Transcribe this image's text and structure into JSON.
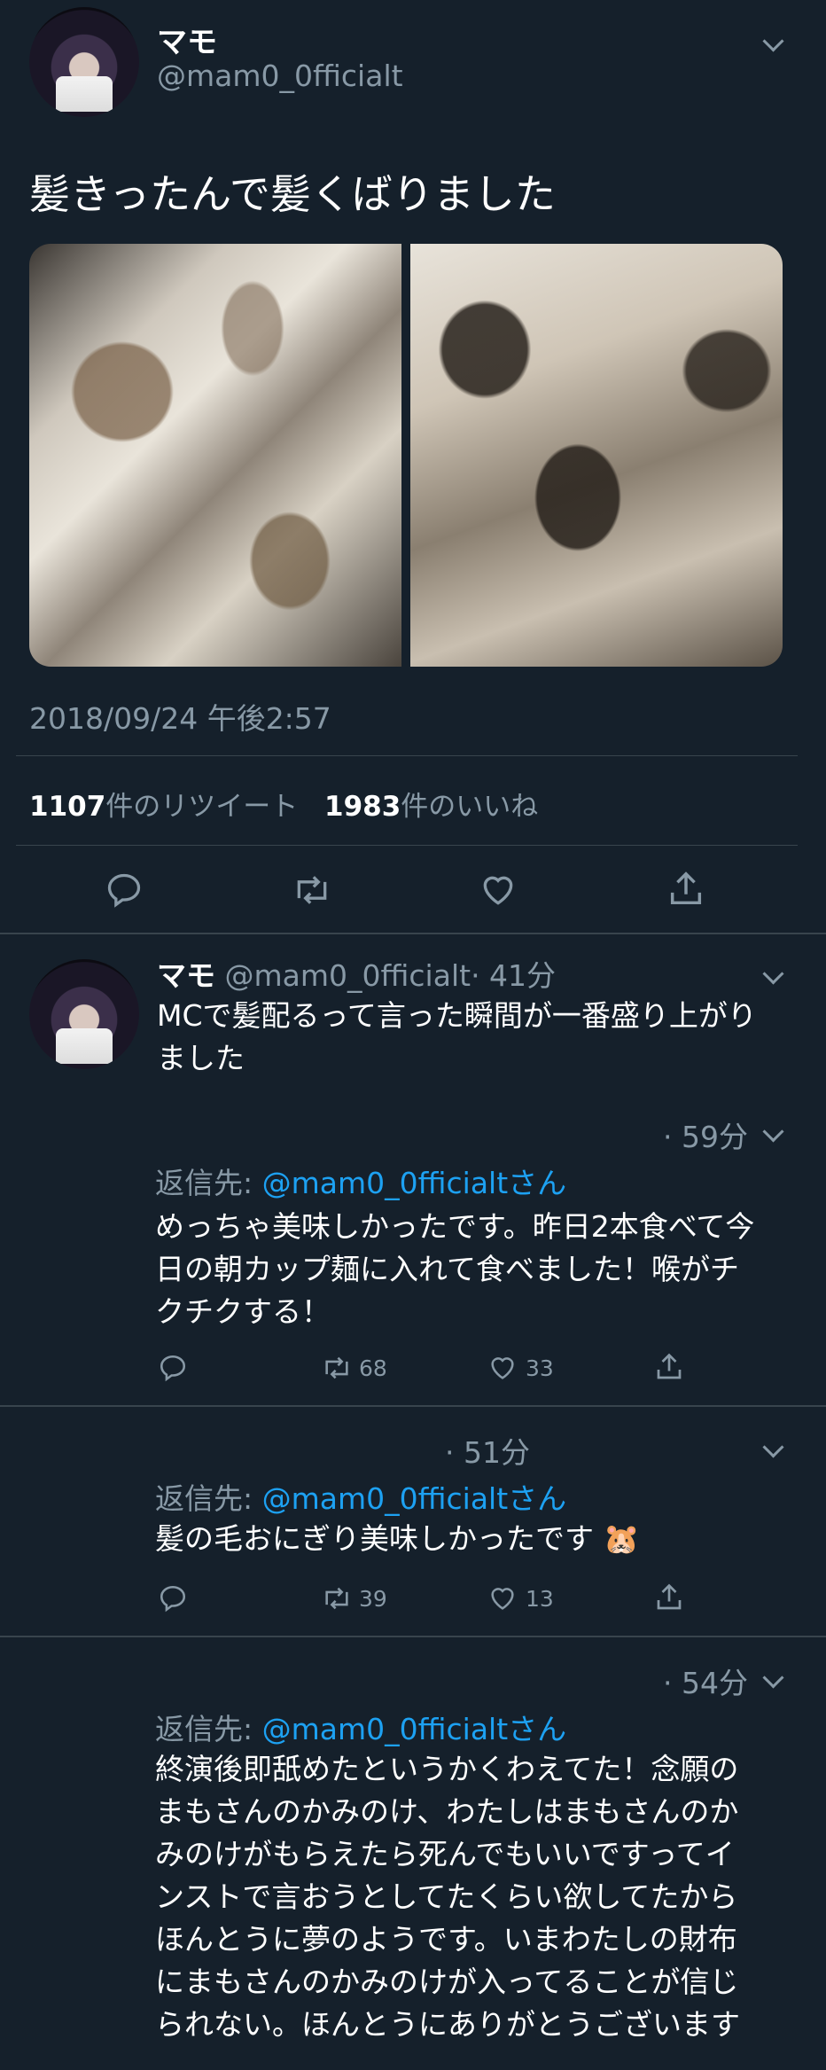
{
  "main_tweet": {
    "name": "マモ",
    "handle": "@mam0_0fficialt",
    "text": "髪きったんで髪くばりました",
    "timestamp": "2018/09/24 午後2:57",
    "retweet_count": "1107",
    "retweet_label": "件のリツイート",
    "like_count": "1983",
    "like_label": "件のいいね"
  },
  "replies": [
    {
      "name": "マモ",
      "handle": "@mam0_0fficialt",
      "time": "· 41分",
      "text_lines": [
        "MCで髪配るって言った瞬間が一番盛り上がり",
        "ました"
      ]
    },
    {
      "time": "· 59分",
      "reply_to_prefix": "返信先: ",
      "reply_to_handle": "@mam0_0fficialtさん",
      "text_lines": [
        "めっちゃ美味しかったです。昨日2本食べて今",
        "日の朝カップ麺に入れて食べました！喉がチ",
        "クチクする！"
      ],
      "retweets": "68",
      "likes": "33"
    },
    {
      "time": "· 51分",
      "reply_to_prefix": "返信先: ",
      "reply_to_handle": "@mam0_0fficialtさん",
      "text_lines": [
        "髪の毛おにぎり美味しかったです 🐹"
      ],
      "retweets": "39",
      "likes": "13"
    },
    {
      "time": "· 54分",
      "reply_to_prefix": "返信先: ",
      "reply_to_handle": "@mam0_0fficialtさん",
      "text_lines": [
        "終演後即舐めたというかくわえてた！念願の",
        "まもさんのかみのけ、わたしはまもさんのか",
        "みのけがもらえたら死んでもいいですってイ",
        "ンストで言おうとしてたくらい欲してたから",
        "ほんとうに夢のようです。いまわたしの財布",
        "にまもさんのかみのけが入ってることが信じ",
        "られない。ほんとうにありがとうございます"
      ]
    }
  ],
  "icons": [
    "reply-icon",
    "retweet-icon",
    "like-icon",
    "share-icon",
    "chevron-down-icon"
  ],
  "colors": {
    "background": "#15202b",
    "link": "#1da1f2",
    "muted": "#8899a6",
    "divider": "#38444d"
  }
}
